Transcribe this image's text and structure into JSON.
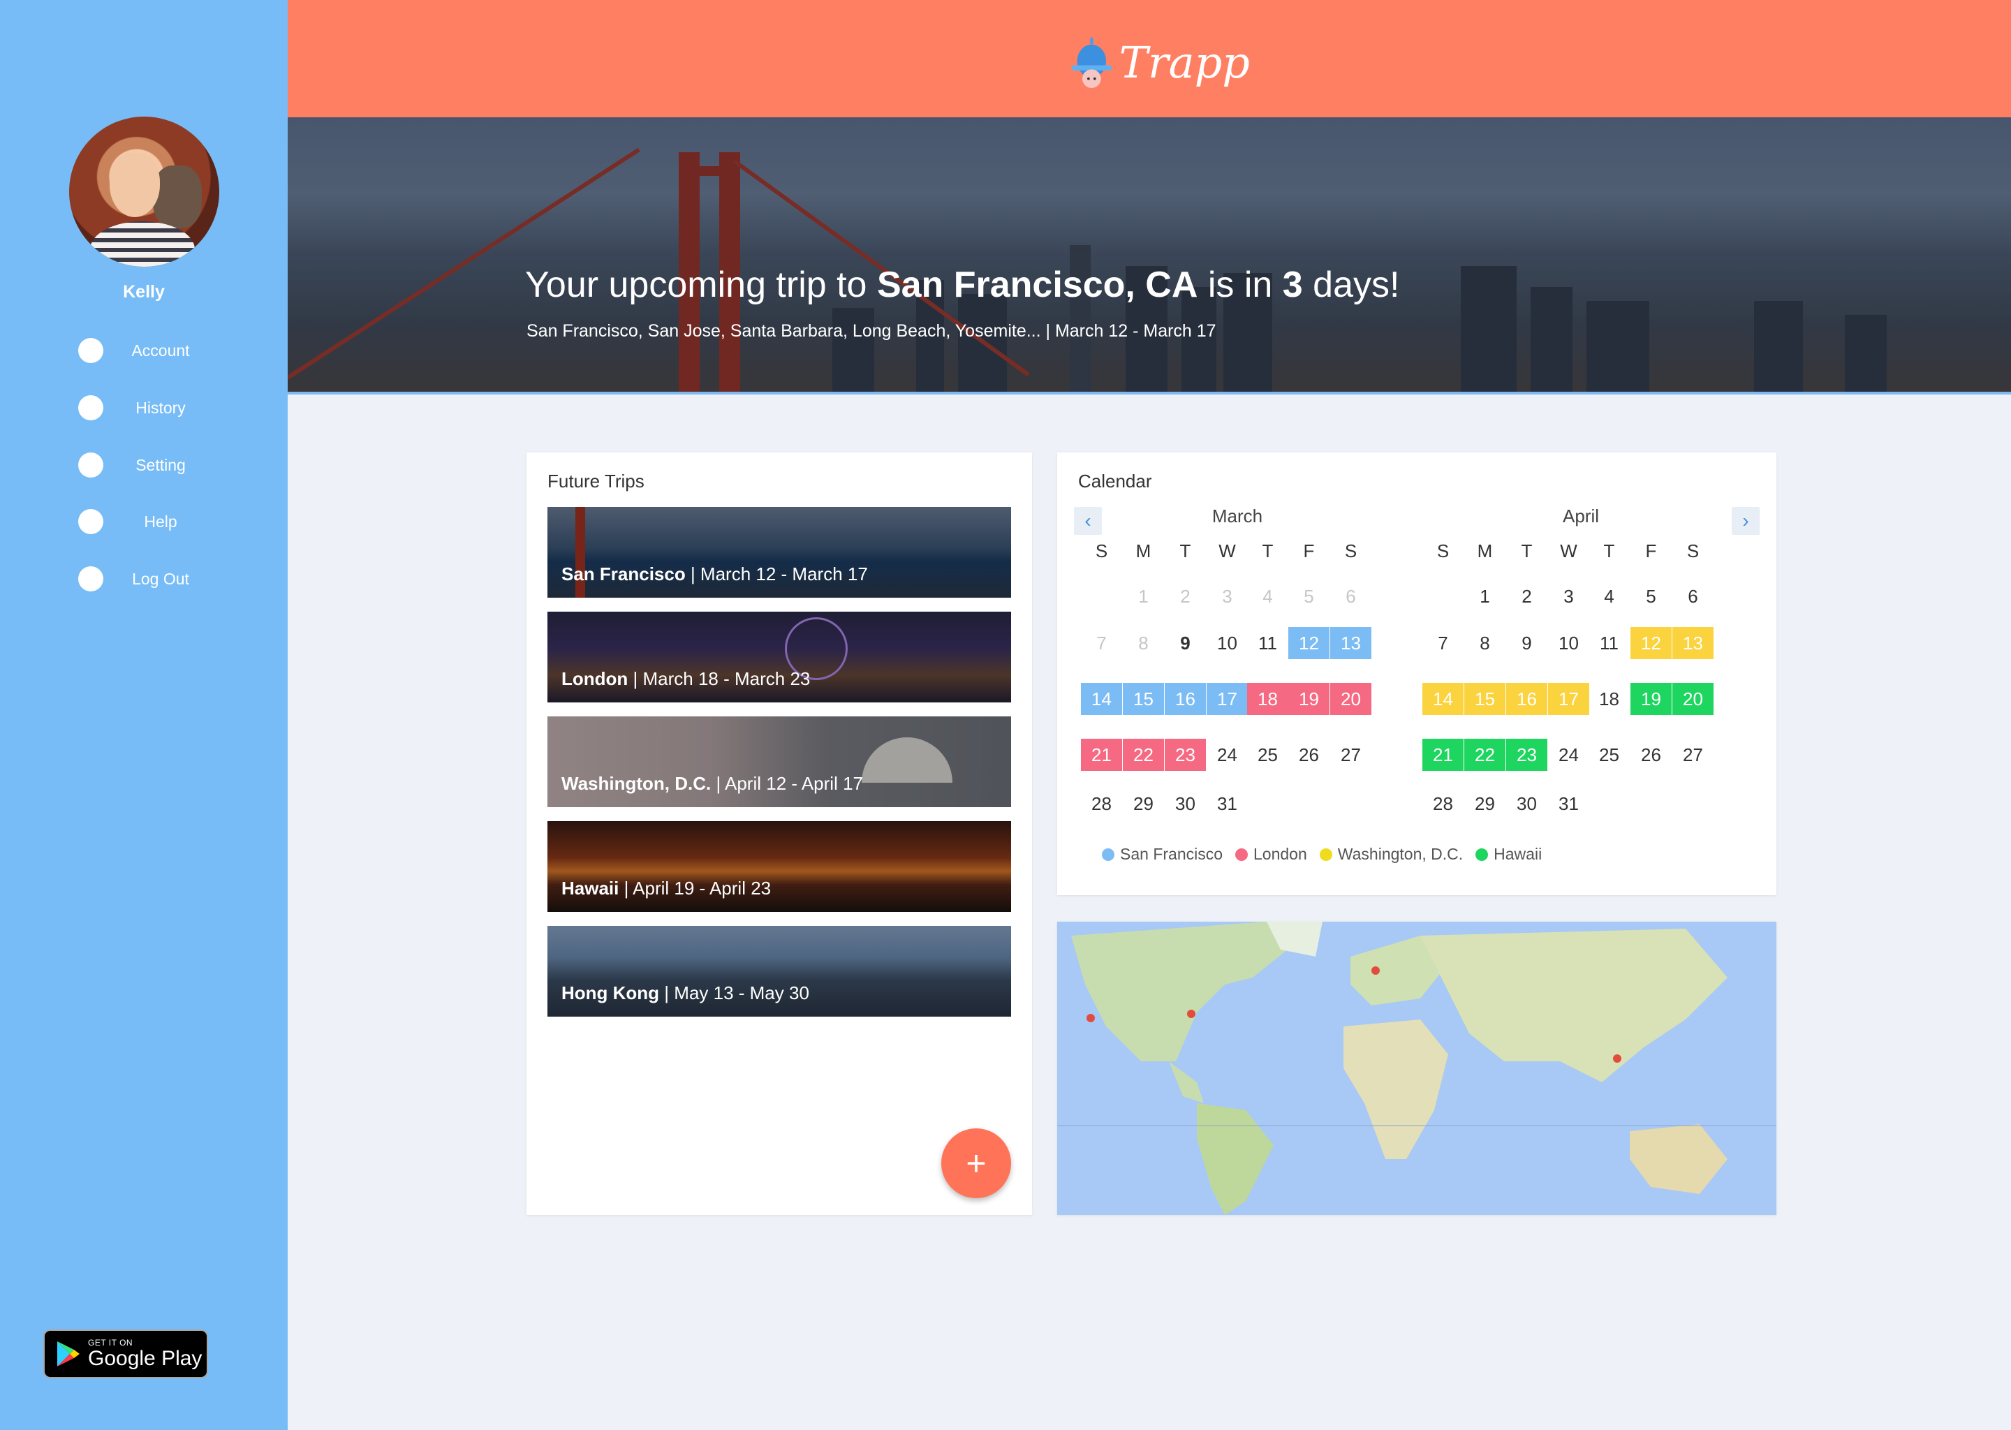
{
  "app": {
    "name": "Trapp"
  },
  "sidebar": {
    "user_name": "Kelly",
    "items": [
      {
        "label": "Account"
      },
      {
        "label": "History"
      },
      {
        "label": "Setting"
      },
      {
        "label": "Help"
      },
      {
        "label": "Log Out"
      }
    ],
    "store_badge": {
      "small": "GET IT ON",
      "big": "Google Play"
    }
  },
  "hero": {
    "title_pre": "Your upcoming trip to ",
    "title_place": "San Francisco, CA",
    "title_mid": " is in ",
    "title_days": "3",
    "title_post": " days!",
    "subtitle": "San Francisco, San Jose, Santa Barbara, Long Beach, Yosemite... | March 12 - March 17"
  },
  "trips": {
    "title": "Future Trips",
    "items": [
      {
        "place": "San Francisco",
        "dates": " | March 12 - March 17"
      },
      {
        "place": "London",
        "dates": " | March 18 - March 23"
      },
      {
        "place": "Washington, D.C.",
        "dates": " | April 12 - April 17"
      },
      {
        "place": "Hawaii",
        "dates": " | April 19 - April 23"
      },
      {
        "place": "Hong Kong",
        "dates": " | May 13 - May 30"
      }
    ],
    "add_label": "+"
  },
  "calendar": {
    "title": "Calendar",
    "prev": "‹",
    "next": "›",
    "weekdays": [
      "S",
      "M",
      "T",
      "W",
      "T",
      "F",
      "S"
    ],
    "months": [
      {
        "name": "March",
        "weeks": [
          [
            {
              "d": ""
            },
            {
              "d": "1",
              "s": "faded"
            },
            {
              "d": "2",
              "s": "faded"
            },
            {
              "d": "3",
              "s": "faded"
            },
            {
              "d": "4",
              "s": "faded"
            },
            {
              "d": "5",
              "s": "faded"
            },
            {
              "d": "6",
              "s": "faded"
            }
          ],
          [
            {
              "d": "7",
              "s": "faded"
            },
            {
              "d": "8",
              "s": "faded"
            },
            {
              "d": "9",
              "s": "today"
            },
            {
              "d": "10"
            },
            {
              "d": "11"
            },
            {
              "d": "12",
              "s": "c-sf"
            },
            {
              "d": "13",
              "s": "c-sf"
            }
          ],
          [
            {
              "d": "14",
              "s": "c-sf"
            },
            {
              "d": "15",
              "s": "c-sf"
            },
            {
              "d": "16",
              "s": "c-sf"
            },
            {
              "d": "17",
              "s": "c-sf"
            },
            {
              "d": "18",
              "s": "c-ld"
            },
            {
              "d": "19",
              "s": "c-ld"
            },
            {
              "d": "20",
              "s": "c-ld"
            }
          ],
          [
            {
              "d": "21",
              "s": "c-ld"
            },
            {
              "d": "22",
              "s": "c-ld"
            },
            {
              "d": "23",
              "s": "c-ld"
            },
            {
              "d": "24"
            },
            {
              "d": "25"
            },
            {
              "d": "26"
            },
            {
              "d": "27"
            }
          ],
          [
            {
              "d": "28"
            },
            {
              "d": "29"
            },
            {
              "d": "30"
            },
            {
              "d": "31"
            },
            {
              "d": ""
            },
            {
              "d": ""
            },
            {
              "d": ""
            }
          ]
        ]
      },
      {
        "name": "April",
        "weeks": [
          [
            {
              "d": ""
            },
            {
              "d": "1"
            },
            {
              "d": "2"
            },
            {
              "d": "3"
            },
            {
              "d": "4"
            },
            {
              "d": "5"
            },
            {
              "d": "6"
            }
          ],
          [
            {
              "d": "7"
            },
            {
              "d": "8"
            },
            {
              "d": "9"
            },
            {
              "d": "10"
            },
            {
              "d": "11"
            },
            {
              "d": "12",
              "s": "c-dc"
            },
            {
              "d": "13",
              "s": "c-dc"
            }
          ],
          [
            {
              "d": "14",
              "s": "c-dc"
            },
            {
              "d": "15",
              "s": "c-dc"
            },
            {
              "d": "16",
              "s": "c-dc"
            },
            {
              "d": "17",
              "s": "c-dc"
            },
            {
              "d": "18"
            },
            {
              "d": "19",
              "s": "c-hi"
            },
            {
              "d": "20",
              "s": "c-hi"
            }
          ],
          [
            {
              "d": "21",
              "s": "c-hi"
            },
            {
              "d": "22",
              "s": "c-hi"
            },
            {
              "d": "23",
              "s": "c-hi"
            },
            {
              "d": "24"
            },
            {
              "d": "25"
            },
            {
              "d": "26"
            },
            {
              "d": "27"
            }
          ],
          [
            {
              "d": "28"
            },
            {
              "d": "29"
            },
            {
              "d": "30"
            },
            {
              "d": "31"
            },
            {
              "d": ""
            },
            {
              "d": ""
            },
            {
              "d": ""
            }
          ]
        ]
      }
    ],
    "legend": [
      {
        "label": "San Francisco",
        "color": "#7cbcf4"
      },
      {
        "label": "London",
        "color": "#f56a82"
      },
      {
        "label": "Washington, D.C.",
        "color": "#f0dc1e"
      },
      {
        "label": "Hawaii",
        "color": "#1ed65f"
      }
    ]
  },
  "colors": {
    "sidebar": "#77bcf6",
    "header": "#ff7f62",
    "background": "#eef2f8",
    "fab": "#ff7459"
  }
}
